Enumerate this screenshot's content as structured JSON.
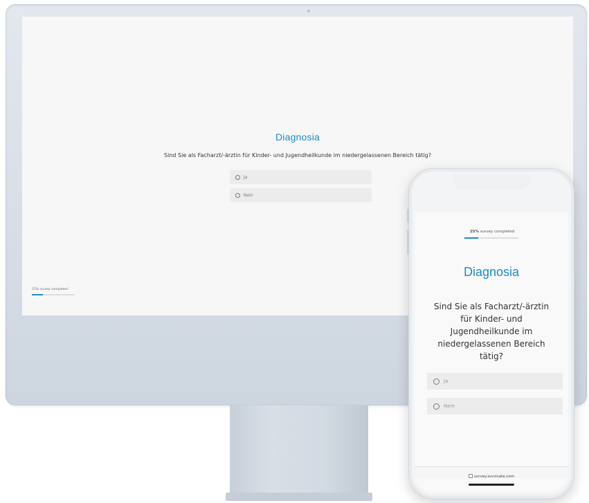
{
  "brand": "Diagnosia",
  "question": "Sind Sie als Facharzt/-ärztin für Kinder- und Jugendheilkunde im niedergelassenen Bereich tätig?",
  "options": [
    {
      "label": "Ja"
    },
    {
      "label": "Nein"
    }
  ],
  "progress": {
    "percent": 25,
    "percent_text": "25%",
    "suffix": " survey completed",
    "full_text": "25% survey completed"
  },
  "phone": {
    "url": "survey.survicate.com"
  },
  "colors": {
    "accent": "#1a8cc2",
    "option_bg": "#ececec",
    "monitor_frame": "#d9dfe7"
  },
  "icons": {
    "radio": "radio-empty-icon",
    "lock": "lock-icon"
  }
}
